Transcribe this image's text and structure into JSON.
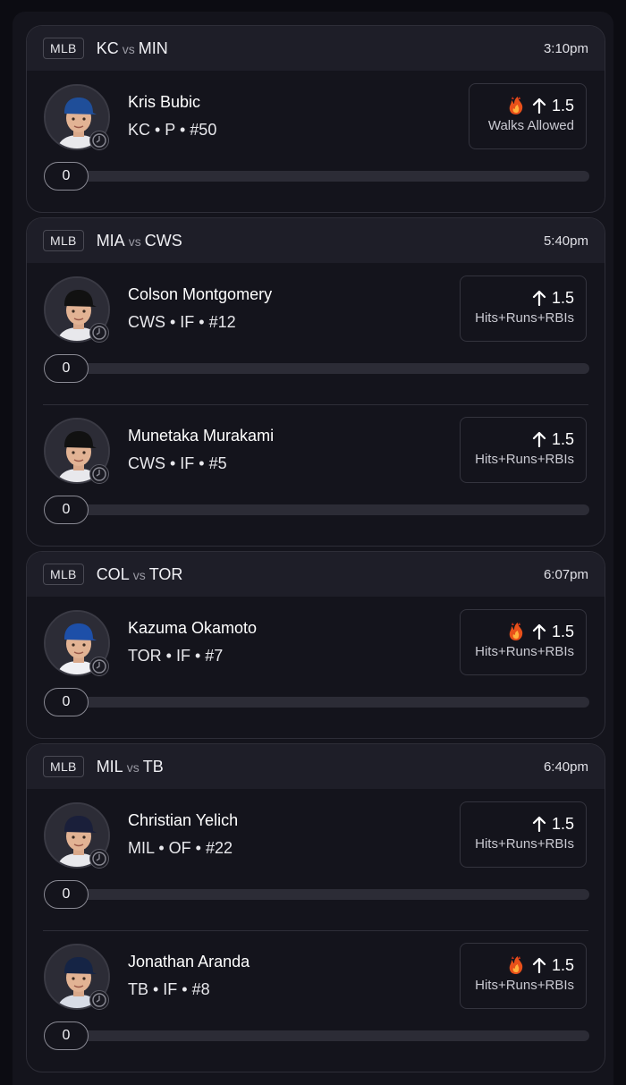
{
  "games": [
    {
      "league": "MLB",
      "home": "KC",
      "vs": "vs",
      "away": "MIN",
      "time": "3:10pm",
      "players": [
        {
          "name": "Kris Bubic",
          "meta": "KC • P • #50",
          "line": "1.5",
          "stat": "Walks Allowed",
          "hot": true,
          "progress": "0",
          "cap_color": "#1f4e99",
          "jersey": "#e8e8ec"
        }
      ]
    },
    {
      "league": "MLB",
      "home": "MIA",
      "vs": "vs",
      "away": "CWS",
      "time": "5:40pm",
      "players": [
        {
          "name": "Colson Montgomery",
          "meta": "CWS • IF • #12",
          "line": "1.5",
          "stat": "Hits+Runs+RBIs",
          "hot": false,
          "progress": "0",
          "cap_color": "#111111",
          "jersey": "#e8e8ec"
        },
        {
          "name": "Munetaka Murakami",
          "meta": "CWS • IF • #5",
          "line": "1.5",
          "stat": "Hits+Runs+RBIs",
          "hot": false,
          "progress": "0",
          "cap_color": "#111111",
          "jersey": "#e8e8ec"
        }
      ]
    },
    {
      "league": "MLB",
      "home": "COL",
      "vs": "vs",
      "away": "TOR",
      "time": "6:07pm",
      "players": [
        {
          "name": "Kazuma Okamoto",
          "meta": "TOR • IF • #7",
          "line": "1.5",
          "stat": "Hits+Runs+RBIs",
          "hot": true,
          "progress": "0",
          "cap_color": "#1d4fa8",
          "jersey": "#f0f0f4"
        }
      ]
    },
    {
      "league": "MLB",
      "home": "MIL",
      "vs": "vs",
      "away": "TB",
      "time": "6:40pm",
      "players": [
        {
          "name": "Christian Yelich",
          "meta": "MIL • OF • #22",
          "line": "1.5",
          "stat": "Hits+Runs+RBIs",
          "hot": false,
          "progress": "0",
          "cap_color": "#1a1f3a",
          "jersey": "#e8e8ec"
        },
        {
          "name": "Jonathan Aranda",
          "meta": "TB • IF • #8",
          "line": "1.5",
          "stat": "Hits+Runs+RBIs",
          "hot": true,
          "progress": "0",
          "cap_color": "#152445",
          "jersey": "#d8dce6"
        }
      ]
    }
  ],
  "icons": {
    "arrow": "arrow-up-icon",
    "flame": "devil-flame-icon",
    "clock": "clock-icon"
  },
  "colors": {
    "background": "#0c0c12",
    "card": "#14141c",
    "header": "#1e1e28",
    "border": "#2e2e38",
    "flame": "#e8501a"
  }
}
